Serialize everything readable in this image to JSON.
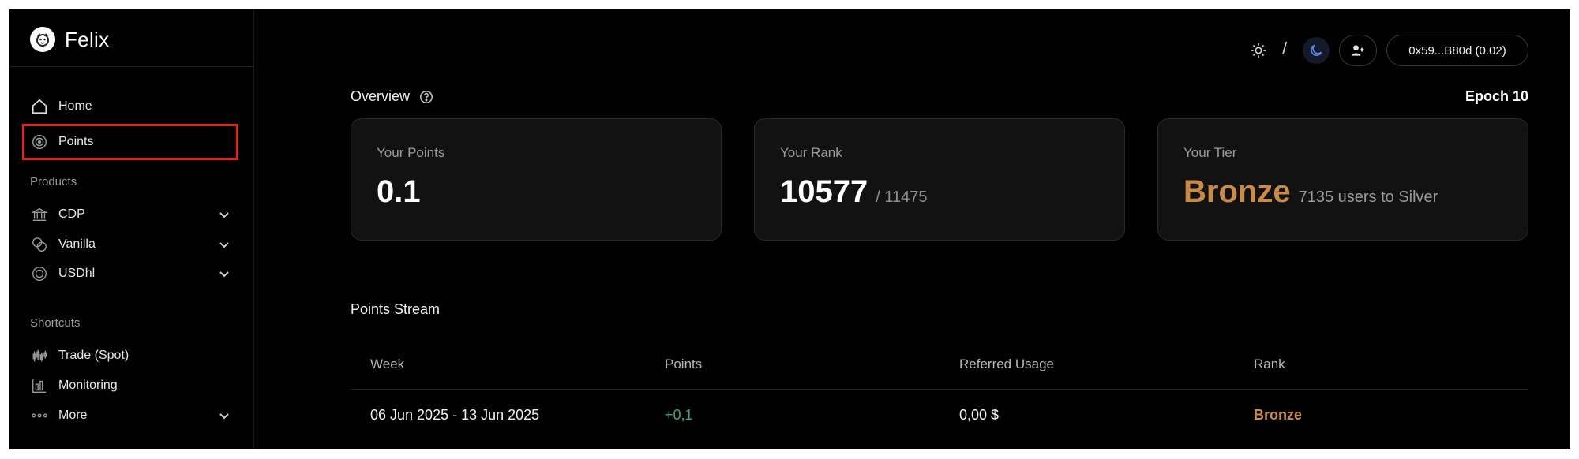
{
  "app": {
    "name": "Felix"
  },
  "sidebar": {
    "nav": [
      {
        "label": "Home",
        "icon": "home-icon"
      },
      {
        "label": "Points",
        "icon": "target-icon"
      }
    ],
    "products_title": "Products",
    "products": [
      {
        "label": "CDP",
        "icon": "bank-icon"
      },
      {
        "label": "Vanilla",
        "icon": "coins-icon"
      },
      {
        "label": "USDhl",
        "icon": "coin-icon"
      }
    ],
    "shortcuts_title": "Shortcuts",
    "shortcuts": [
      {
        "label": "Trade (Spot)",
        "icon": "candlestick-icon"
      },
      {
        "label": "Monitoring",
        "icon": "bar-chart-icon"
      },
      {
        "label": "More",
        "icon": "dots-icon"
      }
    ]
  },
  "header": {
    "theme_separator": "/",
    "wallet_label": "0x59...B80d (0.02)",
    "active_theme": "dark",
    "accent_color": "#5e86e8"
  },
  "overview": {
    "title": "Overview",
    "epoch": "Epoch 10",
    "cards": {
      "points": {
        "label": "Your Points",
        "value": "0.1"
      },
      "rank": {
        "label": "Your Rank",
        "value": "10577",
        "total": "/ 11475"
      },
      "tier": {
        "label": "Your Tier",
        "value": "Bronze",
        "note": "7135 users to Silver",
        "color": "#c98a4a"
      }
    }
  },
  "stream": {
    "title": "Points Stream",
    "columns": [
      "Week",
      "Points",
      "Referred Usage",
      "Rank"
    ],
    "rows": [
      {
        "week": "06 Jun 2025 - 13 Jun 2025",
        "points": "+0,1",
        "usage": "0,00 $",
        "rank": "Bronze"
      }
    ]
  }
}
